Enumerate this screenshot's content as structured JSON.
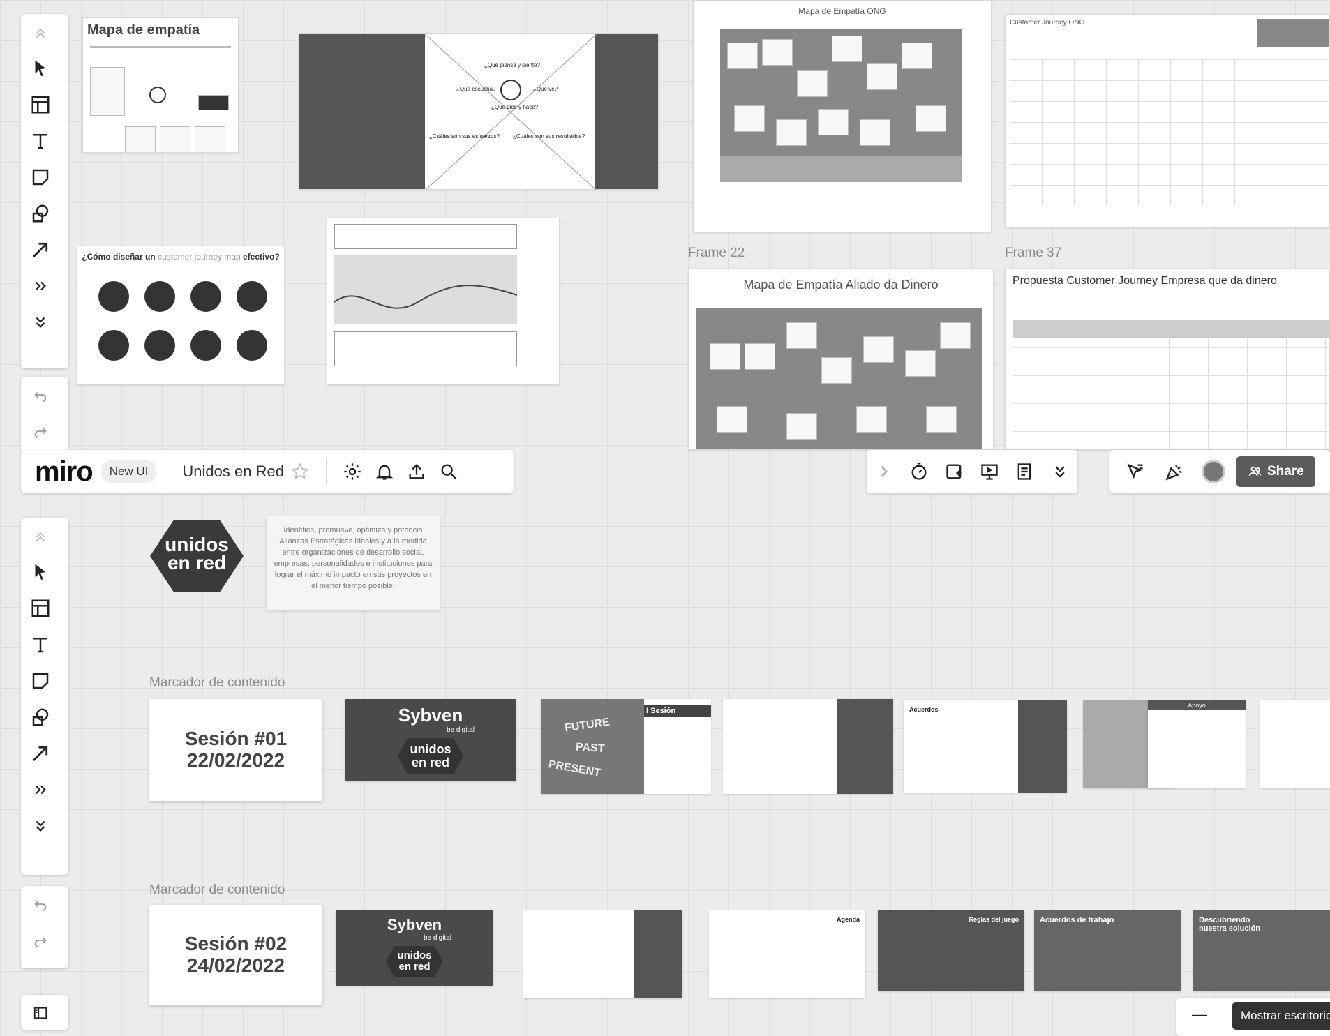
{
  "app": {
    "logo": "miro",
    "badge": "New UI",
    "board_title": "Unidos en Red",
    "share_label": "Share"
  },
  "frames": {
    "mapa_empatia_title": "Mapa de empatía",
    "mapa_ong_title": "Mapa de Empatía ONG",
    "cj_ong_title": "Customer Journey  ONG",
    "frame22_label": "Frame 22",
    "frame37_label": "Frame 37",
    "mapa_aliado_title": "Mapa de Empatía Aliado da Dinero",
    "propuesta_title": "Propuesta Customer Journey Empresa que da dinero",
    "disenar_title": "¿Cómo diseñar un customer journey map efectivo?",
    "disenar_bold": "¿Cómo diseñar un",
    "disenar_accent": "customer journey map",
    "disenar_end": "efectivo?"
  },
  "empathy_center": {
    "piensa": "¿Qué piensa y siente?",
    "escucha": "¿Qué escucha?",
    "ve": "¿Qué ve?",
    "dice": "¿Qué dice y hace?",
    "esfuerzos": "¿Cuáles son sus esfuerzos?",
    "resultados": "¿Cuáles son sus resultados?"
  },
  "unidos": {
    "logo_line1": "unidos",
    "logo_line2": "en red",
    "description": "Identifica, promueve, optimiza y potencia Alianzas Estratégicas ideales y a la medida entre organizaciones de desarrollo social, empresas, personalidades e instituciones para lograr el máximo impacto en sus proyectos en el menor tiempo posible."
  },
  "sections": [
    {
      "label": "Marcador de contenido",
      "session": "Sesión #01",
      "date": "22/02/2022"
    },
    {
      "label": "Marcador de contenido",
      "session": "Sesión #02",
      "date": "24/02/2022"
    }
  ],
  "thumbs": {
    "sybven": "Sybven",
    "sybven_sub": "be digital",
    "futuro": [
      "FUTURE",
      "PAST",
      "PRESENT"
    ],
    "i_sesion": "I Sesión",
    "acuerdos": "Acuerdos",
    "apoyo": "Apoyo",
    "agenda": "Agenda",
    "reglas": "Reglas del juego",
    "acuerdos_trabajo": "Acuerdos de trabajo",
    "descubriendo": "Descubriendo nuestra solución"
  },
  "tooltip": "Mostrar escritorio",
  "zoom_minus": "—"
}
